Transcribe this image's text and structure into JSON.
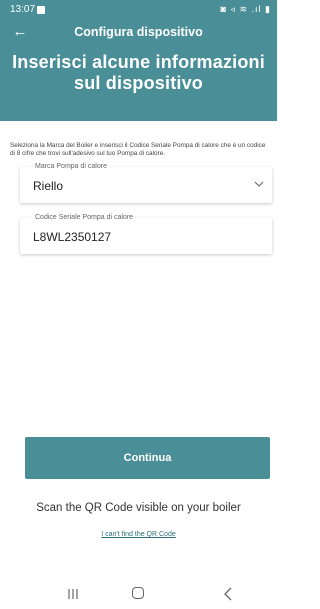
{
  "status_bar": {
    "time": "13:07",
    "icons": [
      "message-icon",
      "battery-saver-icon",
      "mute-icon",
      "wifi-icon",
      "signal-icon",
      "battery-icon"
    ],
    "right_glyphs": "◙ ◃ ≋ .ıl ▮"
  },
  "header": {
    "title": "Configura dispositivo",
    "back_glyph": "←",
    "headline": "Inserisci alcune informazioni sul dispositivo"
  },
  "form": {
    "instructions": "Seleziona la Marca del Boiler e inserisci il Codice Seriale Pompa di calore che è un codice di 8 cifre che trovi sull'adesivo sul tuo Pompa di calore.",
    "brand": {
      "label": "Marca Pompa di calore",
      "value": "Riello"
    },
    "serial": {
      "label": "Codice Seriale Pompa di calore",
      "value": "L8WL2350127"
    }
  },
  "actions": {
    "continue_label": "Continua",
    "qr_text": "Scan the QR Code visible on your boiler",
    "qr_link": "I can't find the QR Code"
  },
  "colors": {
    "primary": "#4a8f98",
    "link": "#2b6f7a",
    "background": "#ffffff"
  }
}
